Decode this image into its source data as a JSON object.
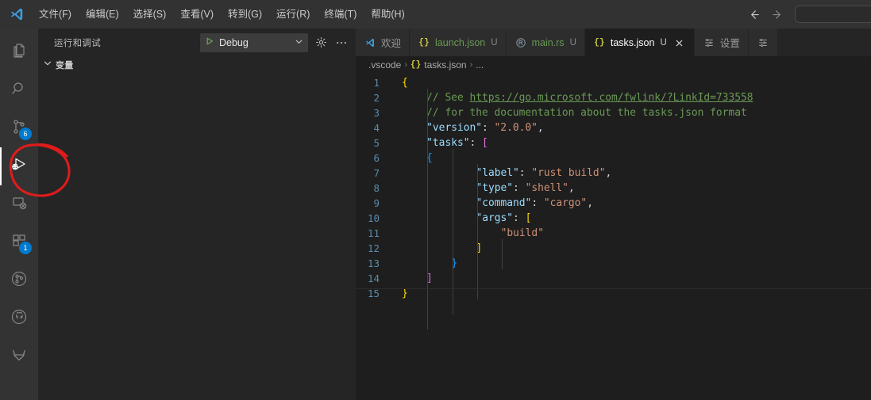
{
  "titlebar": {
    "logo_icon": "vscode-logo-icon",
    "menus": [
      {
        "label": "文件(F)",
        "name": "menu-file"
      },
      {
        "label": "编辑(E)",
        "name": "menu-edit"
      },
      {
        "label": "选择(S)",
        "name": "menu-selection"
      },
      {
        "label": "查看(V)",
        "name": "menu-view"
      },
      {
        "label": "转到(G)",
        "name": "menu-go"
      },
      {
        "label": "运行(R)",
        "name": "menu-run"
      },
      {
        "label": "终端(T)",
        "name": "menu-terminal"
      },
      {
        "label": "帮助(H)",
        "name": "menu-help"
      }
    ],
    "back_icon": "arrow-left-icon",
    "forward_icon": "arrow-right-icon",
    "command_center_value": "",
    "command_center_placeholder": ""
  },
  "activitybar": {
    "items": [
      {
        "name": "explorer",
        "icon": "files-icon",
        "badge": "",
        "active": false
      },
      {
        "name": "search",
        "icon": "search-icon",
        "badge": "",
        "active": false
      },
      {
        "name": "source-control",
        "icon": "source-control-icon",
        "badge": "6",
        "active": false
      },
      {
        "name": "run-and-debug",
        "icon": "run-debug-icon",
        "badge": "",
        "active": true
      },
      {
        "name": "remote-explorer",
        "icon": "remote-explorer-icon",
        "badge": "",
        "active": false
      },
      {
        "name": "extensions",
        "icon": "extensions-icon",
        "badge": "1",
        "active": false
      },
      {
        "name": "gitlens",
        "icon": "gitlens-icon",
        "badge": "",
        "active": false
      },
      {
        "name": "github",
        "icon": "github-icon",
        "badge": "",
        "active": false
      },
      {
        "name": "gitlab",
        "icon": "gitlab-icon",
        "badge": "",
        "active": false
      }
    ],
    "annotation": {
      "shape": "red-ellipse",
      "color": "#e01b1b",
      "targets": "run-and-debug"
    }
  },
  "sidebar": {
    "title": "运行和调试",
    "config_name": "Debug",
    "play_icon": "play-triangle-icon",
    "chevron_icon": "chevron-down-icon",
    "gear_icon": "gear-icon",
    "more_icon": "ellipsis-icon",
    "sections": [
      {
        "name": "variables",
        "label": "变量",
        "expanded": true
      }
    ]
  },
  "tabs": [
    {
      "name": "tab-welcome",
      "label": "欢迎",
      "icon": "vscode-logo-icon",
      "dirty": "",
      "active": false,
      "closable": false
    },
    {
      "name": "tab-launch-json",
      "label": "launch.json",
      "icon": "json-icon",
      "dirty": "U",
      "active": false,
      "closable": false
    },
    {
      "name": "tab-main-rs",
      "label": "main.rs",
      "icon": "rust-icon",
      "dirty": "U",
      "active": false,
      "closable": false
    },
    {
      "name": "tab-tasks-json",
      "label": "tasks.json",
      "icon": "json-icon",
      "dirty": "U",
      "active": true,
      "closable": true
    },
    {
      "name": "tab-settings",
      "label": "设置",
      "icon": "settings-list-icon",
      "dirty": "",
      "active": false,
      "closable": false
    },
    {
      "name": "tab-overflow",
      "label": "",
      "icon": "settings-list-icon",
      "dirty": "",
      "active": false,
      "closable": false
    }
  ],
  "breadcrumb": {
    "folder": ".vscode",
    "file": "tasks.json",
    "file_icon": "json-icon",
    "overflow": "...",
    "separator": "›"
  },
  "editor": {
    "file": "tasks.json",
    "line_numbers": [
      "1",
      "2",
      "3",
      "4",
      "5",
      "6",
      "7",
      "8",
      "9",
      "10",
      "11",
      "12",
      "13",
      "14",
      "15"
    ],
    "lines": [
      {
        "n": 1,
        "text": "{"
      },
      {
        "n": 2,
        "text": "    // See https://go.microsoft.com/fwlink/?LinkId=733558"
      },
      {
        "n": 3,
        "text": "    // for the documentation about the tasks.json format"
      },
      {
        "n": 4,
        "text": "    \"version\": \"2.0.0\","
      },
      {
        "n": 5,
        "text": "    \"tasks\": ["
      },
      {
        "n": 6,
        "text": "        {"
      },
      {
        "n": 7,
        "text": "            \"label\": \"rust build\","
      },
      {
        "n": 8,
        "text": "            \"type\": \"shell\","
      },
      {
        "n": 9,
        "text": "            \"command\": \"cargo\","
      },
      {
        "n": 10,
        "text": "            \"args\": ["
      },
      {
        "n": 11,
        "text": "                \"build\""
      },
      {
        "n": 12,
        "text": "            ]"
      },
      {
        "n": 13,
        "text": "        }"
      },
      {
        "n": 14,
        "text": "    ]"
      },
      {
        "n": 15,
        "text": "}"
      }
    ],
    "tokens": {
      "comment_see": "// See ",
      "comment_url": "https://go.microsoft.com/fwlink/?LinkId=733558",
      "comment_for": "// for the documentation about the tasks.json format",
      "key_version": "\"version\"",
      "val_version": "\"2.0.0\"",
      "key_tasks": "\"tasks\"",
      "key_label": "\"label\"",
      "val_label": "\"rust build\"",
      "key_type": "\"type\"",
      "val_type": "\"shell\"",
      "key_command": "\"command\"",
      "val_command": "\"cargo\"",
      "key_args": "\"args\"",
      "val_args_build": "\"build\""
    }
  },
  "colors": {
    "accent": "#007acc",
    "annotation_red": "#e01b1b",
    "titlebar_bg": "#323233",
    "activitybar_bg": "#333333",
    "sidebar_bg": "#252526",
    "editor_bg": "#1e1e1e",
    "tab_inactive_bg": "#2d2d2d",
    "comment_green": "#6a9955",
    "string_orange": "#ce9178",
    "key_blue": "#9cdcfe",
    "bracket_yellow": "#ffd700",
    "bracket_pink": "#da70d6",
    "bracket_blue": "#179fff",
    "linenumber_blue": "#5a8bab"
  }
}
